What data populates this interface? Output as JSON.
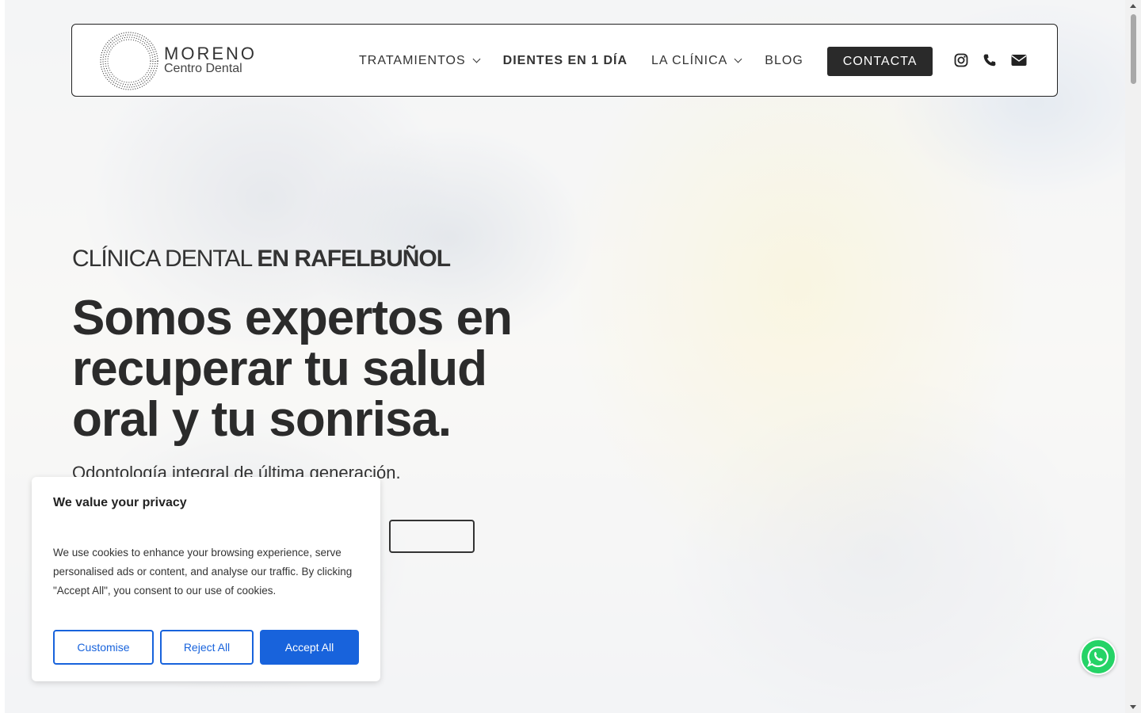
{
  "brand": {
    "title": "MORENO",
    "subtitle": "Centro Dental"
  },
  "nav": {
    "items": [
      {
        "label": "TRATAMIENTOS",
        "has_dropdown": true
      },
      {
        "label": "DIENTES EN 1 DÍA",
        "has_dropdown": false
      },
      {
        "label": "LA CLÍNICA",
        "has_dropdown": true
      },
      {
        "label": "BLOG",
        "has_dropdown": false
      }
    ],
    "cta_label": "CONTACTA"
  },
  "social": {
    "icons": [
      "instagram-icon",
      "phone-icon",
      "envelope-icon"
    ]
  },
  "hero": {
    "eyebrow_light": "CLÍNICA DENTAL ",
    "eyebrow_bold": "EN RAFELBUÑOL",
    "headline": "Somos expertos en recuperar tu salud oral y tu sonrisa.",
    "subline": "Odontología integral de última generación."
  },
  "cookie": {
    "title": "We value your privacy",
    "text": "We use cookies to enhance your browsing experience, serve personalised ads or content, and analyse our traffic. By clicking \"Accept All\", you consent to our use of cookies.",
    "customise_label": "Customise",
    "reject_label": "Reject All",
    "accept_label": "Accept All"
  },
  "colors": {
    "accent": "#1863dc",
    "dark": "#2a2a2a",
    "whatsapp": "#25d366"
  }
}
